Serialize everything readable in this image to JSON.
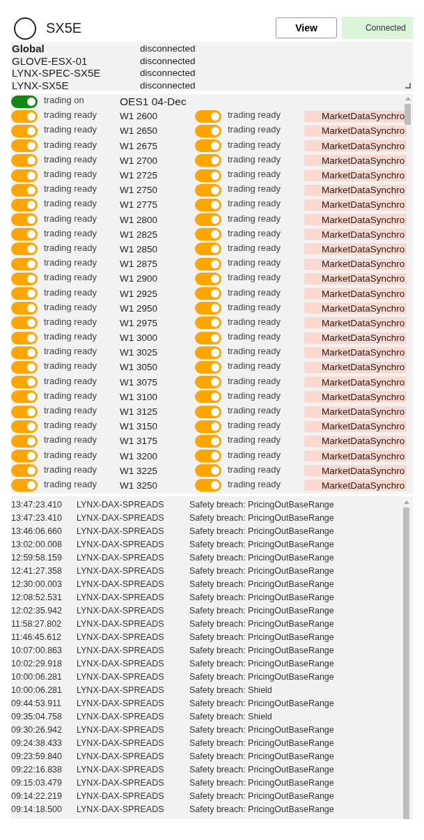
{
  "header": {
    "title": "SX5E",
    "view_button": "View",
    "status_badge": "Connected"
  },
  "connections": [
    {
      "kind": "global",
      "name": "Global",
      "status": "disconnected"
    },
    {
      "kind": "feed",
      "name": "GLOVE-ESX-01",
      "status": "disconnected"
    },
    {
      "kind": "feed",
      "name": "LYNX-SPEC-SX5E",
      "status": "disconnected"
    },
    {
      "kind": "feed",
      "name": "LYNX-SX5E",
      "status": "disconnected"
    }
  ],
  "instruments": [
    {
      "toggle": {
        "kind": "on",
        "label": "trading on"
      },
      "name": "OES1 04-Dec"
    },
    {
      "toggle": {
        "kind": "ready",
        "label": "trading ready"
      },
      "name": "W1 2600",
      "right_toggle": {
        "kind": "ready",
        "label": "trading ready"
      },
      "status": "MarketDataSynchro"
    },
    {
      "toggle": {
        "kind": "ready",
        "label": "trading ready"
      },
      "name": "W1 2650",
      "right_toggle": {
        "kind": "ready",
        "label": "trading ready"
      },
      "status": "MarketDataSynchro"
    },
    {
      "toggle": {
        "kind": "ready",
        "label": "trading ready"
      },
      "name": "W1 2675",
      "right_toggle": {
        "kind": "ready",
        "label": "trading ready"
      },
      "status": "MarketDataSynchro"
    },
    {
      "toggle": {
        "kind": "ready",
        "label": "trading ready"
      },
      "name": "W1 2700",
      "right_toggle": {
        "kind": "ready",
        "label": "trading ready"
      },
      "status": "MarketDataSynchro"
    },
    {
      "toggle": {
        "kind": "ready",
        "label": "trading ready"
      },
      "name": "W1 2725",
      "right_toggle": {
        "kind": "ready",
        "label": "trading ready"
      },
      "status": "MarketDataSynchro"
    },
    {
      "toggle": {
        "kind": "ready",
        "label": "trading ready"
      },
      "name": "W1 2750",
      "right_toggle": {
        "kind": "ready",
        "label": "trading ready"
      },
      "status": "MarketDataSynchro"
    },
    {
      "toggle": {
        "kind": "ready",
        "label": "trading ready"
      },
      "name": "W1 2775",
      "right_toggle": {
        "kind": "ready",
        "label": "trading ready"
      },
      "status": "MarketDataSynchro"
    },
    {
      "toggle": {
        "kind": "ready",
        "label": "trading ready"
      },
      "name": "W1 2800",
      "right_toggle": {
        "kind": "ready",
        "label": "trading ready"
      },
      "status": "MarketDataSynchro"
    },
    {
      "toggle": {
        "kind": "ready",
        "label": "trading ready"
      },
      "name": "W1 2825",
      "right_toggle": {
        "kind": "ready",
        "label": "trading ready"
      },
      "status": "MarketDataSynchro"
    },
    {
      "toggle": {
        "kind": "ready",
        "label": "trading ready"
      },
      "name": "W1 2850",
      "right_toggle": {
        "kind": "ready",
        "label": "trading ready"
      },
      "status": "MarketDataSynchro"
    },
    {
      "toggle": {
        "kind": "ready",
        "label": "trading ready"
      },
      "name": "W1 2875",
      "right_toggle": {
        "kind": "ready",
        "label": "trading ready"
      },
      "status": "MarketDataSynchro"
    },
    {
      "toggle": {
        "kind": "ready",
        "label": "trading ready"
      },
      "name": "W1 2900",
      "right_toggle": {
        "kind": "ready",
        "label": "trading ready"
      },
      "status": "MarketDataSynchro"
    },
    {
      "toggle": {
        "kind": "ready",
        "label": "trading ready"
      },
      "name": "W1 2925",
      "right_toggle": {
        "kind": "ready",
        "label": "trading ready"
      },
      "status": "MarketDataSynchro"
    },
    {
      "toggle": {
        "kind": "ready",
        "label": "trading ready"
      },
      "name": "W1 2950",
      "right_toggle": {
        "kind": "ready",
        "label": "trading ready"
      },
      "status": "MarketDataSynchro"
    },
    {
      "toggle": {
        "kind": "ready",
        "label": "trading ready"
      },
      "name": "W1 2975",
      "right_toggle": {
        "kind": "ready",
        "label": "trading ready"
      },
      "status": "MarketDataSynchro"
    },
    {
      "toggle": {
        "kind": "ready",
        "label": "trading ready"
      },
      "name": "W1 3000",
      "right_toggle": {
        "kind": "ready",
        "label": "trading ready"
      },
      "status": "MarketDataSynchro"
    },
    {
      "toggle": {
        "kind": "ready",
        "label": "trading ready"
      },
      "name": "W1 3025",
      "right_toggle": {
        "kind": "ready",
        "label": "trading ready"
      },
      "status": "MarketDataSynchro"
    },
    {
      "toggle": {
        "kind": "ready",
        "label": "trading ready"
      },
      "name": "W1 3050",
      "right_toggle": {
        "kind": "ready",
        "label": "trading ready"
      },
      "status": "MarketDataSynchro"
    },
    {
      "toggle": {
        "kind": "ready",
        "label": "trading ready"
      },
      "name": "W1 3075",
      "right_toggle": {
        "kind": "ready",
        "label": "trading ready"
      },
      "status": "MarketDataSynchro"
    },
    {
      "toggle": {
        "kind": "ready",
        "label": "trading ready"
      },
      "name": "W1 3100",
      "right_toggle": {
        "kind": "ready",
        "label": "trading ready"
      },
      "status": "MarketDataSynchro"
    },
    {
      "toggle": {
        "kind": "ready",
        "label": "trading ready"
      },
      "name": "W1 3125",
      "right_toggle": {
        "kind": "ready",
        "label": "trading ready"
      },
      "status": "MarketDataSynchro"
    },
    {
      "toggle": {
        "kind": "ready",
        "label": "trading ready"
      },
      "name": "W1 3150",
      "right_toggle": {
        "kind": "ready",
        "label": "trading ready"
      },
      "status": "MarketDataSynchro"
    },
    {
      "toggle": {
        "kind": "ready",
        "label": "trading ready"
      },
      "name": "W1 3175",
      "right_toggle": {
        "kind": "ready",
        "label": "trading ready"
      },
      "status": "MarketDataSynchro"
    },
    {
      "toggle": {
        "kind": "ready",
        "label": "trading ready"
      },
      "name": "W1 3200",
      "right_toggle": {
        "kind": "ready",
        "label": "trading ready"
      },
      "status": "MarketDataSynchro"
    },
    {
      "toggle": {
        "kind": "ready",
        "label": "trading ready"
      },
      "name": "W1 3225",
      "right_toggle": {
        "kind": "ready",
        "label": "trading ready"
      },
      "status": "MarketDataSynchro"
    },
    {
      "toggle": {
        "kind": "ready",
        "label": "trading ready"
      },
      "name": "W1 3250",
      "right_toggle": {
        "kind": "ready",
        "label": "trading ready"
      },
      "status": "MarketDataSynchro"
    }
  ],
  "log": [
    {
      "time": "13:47:23.410",
      "source": "LYNX-DAX-SPREADS",
      "message": "Safety breach: PricingOutBaseRange"
    },
    {
      "time": "13:47:23.410",
      "source": "LYNX-DAX-SPREADS",
      "message": "Safety breach: PricingOutBaseRange"
    },
    {
      "time": "13:46:06.660",
      "source": "LYNX-DAX-SPREADS",
      "message": "Safety breach: PricingOutBaseRange"
    },
    {
      "time": "13:02:00.008",
      "source": "LYNX-DAX-SPREADS",
      "message": "Safety breach: PricingOutBaseRange"
    },
    {
      "time": "12:59:58.159",
      "source": "LYNX-DAX-SPREADS",
      "message": "Safety breach: PricingOutBaseRange"
    },
    {
      "time": "12:41:27.358",
      "source": "LYNX-DAX-SPREADS",
      "message": "Safety breach: PricingOutBaseRange"
    },
    {
      "time": "12:30:00.003",
      "source": "LYNX-DAX-SPREADS",
      "message": "Safety breach: PricingOutBaseRange"
    },
    {
      "time": "12:08:52.531",
      "source": "LYNX-DAX-SPREADS",
      "message": "Safety breach: PricingOutBaseRange"
    },
    {
      "time": "12:02:35.942",
      "source": "LYNX-DAX-SPREADS",
      "message": "Safety breach: PricingOutBaseRange"
    },
    {
      "time": "11:58:27.802",
      "source": "LYNX-DAX-SPREADS",
      "message": "Safety breach: PricingOutBaseRange"
    },
    {
      "time": "11:46:45.612",
      "source": "LYNX-DAX-SPREADS",
      "message": "Safety breach: PricingOutBaseRange"
    },
    {
      "time": "10:07:00.863",
      "source": "LYNX-DAX-SPREADS",
      "message": "Safety breach: PricingOutBaseRange"
    },
    {
      "time": "10:02:29.918",
      "source": "LYNX-DAX-SPREADS",
      "message": "Safety breach: PricingOutBaseRange"
    },
    {
      "time": "10:00:06.281",
      "source": "LYNX-DAX-SPREADS",
      "message": "Safety breach: PricingOutBaseRange"
    },
    {
      "time": "10:00:06.281",
      "source": "LYNX-DAX-SPREADS",
      "message": "Safety breach: Shield"
    },
    {
      "time": "09:44:53.911",
      "source": "LYNX-DAX-SPREADS",
      "message": "Safety breach: PricingOutBaseRange"
    },
    {
      "time": "09:35:04.758",
      "source": "LYNX-DAX-SPREADS",
      "message": "Safety breach: Shield"
    },
    {
      "time": "09:30:26.942",
      "source": "LYNX-DAX-SPREADS",
      "message": "Safety breach: PricingOutBaseRange"
    },
    {
      "time": "09:24:38.433",
      "source": "LYNX-DAX-SPREADS",
      "message": "Safety breach: PricingOutBaseRange"
    },
    {
      "time": "09:23:59.840",
      "source": "LYNX-DAX-SPREADS",
      "message": "Safety breach: PricingOutBaseRange"
    },
    {
      "time": "09:22:16.838",
      "source": "LYNX-DAX-SPREADS",
      "message": "Safety breach: PricingOutBaseRange"
    },
    {
      "time": "09:15:03.479",
      "source": "LYNX-DAX-SPREADS",
      "message": "Safety breach: PricingOutBaseRange"
    },
    {
      "time": "09:14:22.219",
      "source": "LYNX-DAX-SPREADS",
      "message": "Safety breach: PricingOutBaseRange"
    },
    {
      "time": "09:14:18.500",
      "source": "LYNX-DAX-SPREADS",
      "message": "Safety breach: PricingOutBaseRange"
    }
  ]
}
